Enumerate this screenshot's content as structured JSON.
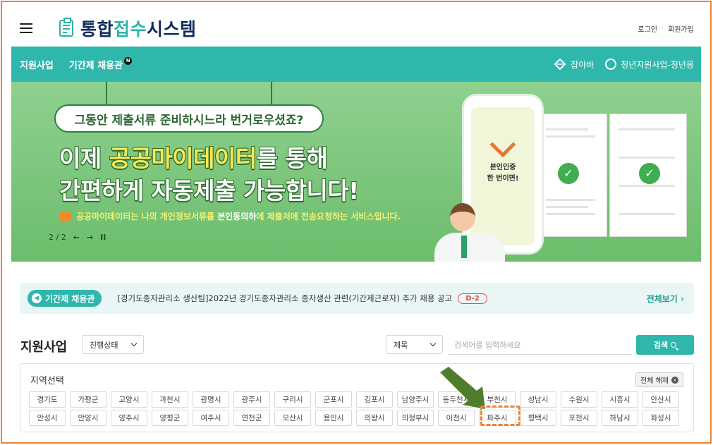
{
  "header": {
    "menu_icon": "hamburger-menu-icon",
    "logo_icon": "clipboard-icon",
    "logo_part1": "통합",
    "logo_part2": "접수",
    "logo_part3": "시스템",
    "login": "로그인",
    "separator": "·",
    "signup": "회원가입"
  },
  "nav": {
    "items": [
      {
        "label": "지원사업"
      },
      {
        "label": "기간제 채용관",
        "badge": "N"
      }
    ],
    "right": [
      {
        "label": "잡아바",
        "icon": "jobaba-logo-icon"
      },
      {
        "label": "청년지원사업-청년몽",
        "icon": "youth-face-icon"
      }
    ],
    "color": "#2fb7ac"
  },
  "banner": {
    "bubble": "그동안 제출서류 준비하시느라 번거로우셨죠?",
    "headline_1a": "이제 ",
    "headline_1b": "공공마이데이터",
    "headline_1c": "를 통해",
    "headline_2": "간편하게 자동제출 가능합니다!",
    "sub_a": "공공마이데이터는 나의 개인정보서류를 ",
    "sub_b": "본인동의하",
    "sub_c": "에 제출처에 전송요청하는 서비스입니다.",
    "phone_line1": "본인인증",
    "phone_line2": "한 번이면!",
    "pager": "2 / 2",
    "prev": "←",
    "next": "→",
    "pause": "II",
    "check_mark": "✓"
  },
  "notice": {
    "pill": "기간제 채용관",
    "pill_icon": "◀",
    "text": "[경기도종자관리소 생산팀]2022년 경기도종자관리소 종자생산 관련(기간제근로자) 추가 채용 공고",
    "dday": "D-2",
    "more": "전체보기 ›"
  },
  "filters": {
    "title": "지원사업",
    "status_select": "진행상태",
    "field_select": "제목",
    "search_placeholder": "검색어를 입력하세요",
    "search_button": "검색"
  },
  "region": {
    "title": "지역선택",
    "reset": "전체 해제",
    "reset_icon": "×",
    "row1": [
      "경기도",
      "가평군",
      "고양시",
      "과천시",
      "광명시",
      "광주시",
      "구리시",
      "군포시",
      "김포시",
      "남양주시",
      "동두천시",
      "부천시",
      "성남시",
      "수원시",
      "시흥시",
      "안산시"
    ],
    "row2": [
      "안성시",
      "안양시",
      "양주시",
      "양평군",
      "여주시",
      "연천군",
      "오산시",
      "용인시",
      "의왕시",
      "의정부시",
      "이천시",
      "파주시",
      "평택시",
      "포천시",
      "하남시",
      "화성시"
    ]
  },
  "colors": {
    "accent": "#2fb7ac",
    "highlight": "#e8843a",
    "arrow": "#4f7d2b"
  }
}
